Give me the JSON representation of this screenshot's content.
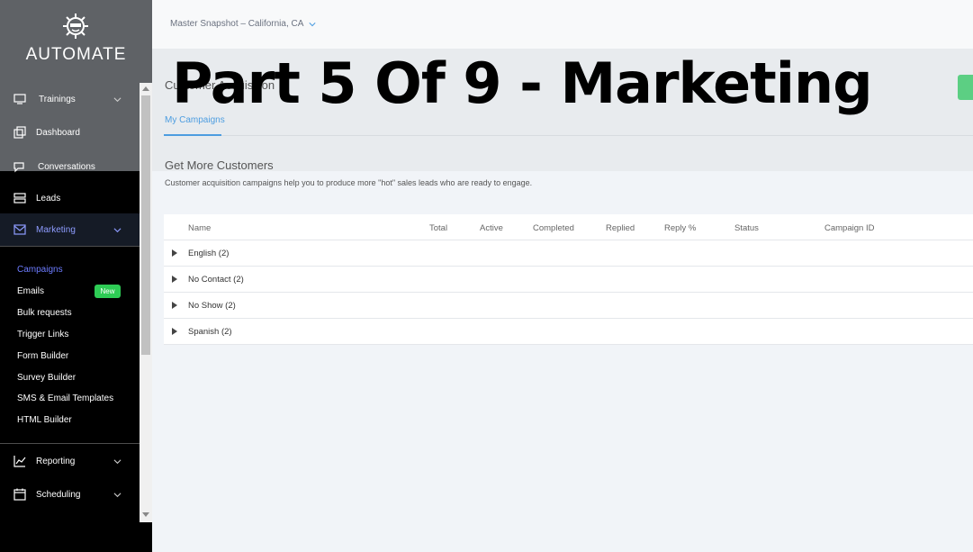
{
  "sidebar": {
    "logo_text": "AUTOMATE",
    "nav": {
      "trainings": "Trainings",
      "dashboard": "Dashboard",
      "conversations": "Conversations",
      "leads": "Leads",
      "marketing": "Marketing",
      "reporting": "Reporting",
      "scheduling": "Scheduling"
    },
    "marketing_sub": {
      "campaigns": "Campaigns",
      "emails": "Emails",
      "emails_badge": "New",
      "bulk_requests": "Bulk requests",
      "trigger_links": "Trigger Links",
      "form_builder": "Form Builder",
      "survey_builder": "Survey Builder",
      "sms_email_templates": "SMS & Email Templates",
      "html_builder": "HTML Builder"
    }
  },
  "topbar": {
    "location": "Master Snapshot – California, CA"
  },
  "page": {
    "title": "Customer Acquisition",
    "tab": "My Campaigns",
    "section_title": "Get More Customers",
    "section_desc": "Customer acquisition campaigns help you to produce more \"hot\" sales leads who are ready to engage."
  },
  "table": {
    "headers": {
      "name": "Name",
      "total": "Total",
      "active": "Active",
      "completed": "Completed",
      "replied": "Replied",
      "reply_pct": "Reply %",
      "status": "Status",
      "campaign_id": "Campaign ID"
    },
    "groups": [
      "English (2)",
      "No Contact (2)",
      "No Show (2)",
      "Spanish (2)"
    ]
  },
  "overlay": {
    "title": "Part 5 Of 9 - Marketing"
  },
  "colors": {
    "accent_blue": "#4d9de0",
    "campaigns_active": "#6d7cff",
    "new_badge": "#2ecc55",
    "sidebar_bg": "#000000"
  }
}
